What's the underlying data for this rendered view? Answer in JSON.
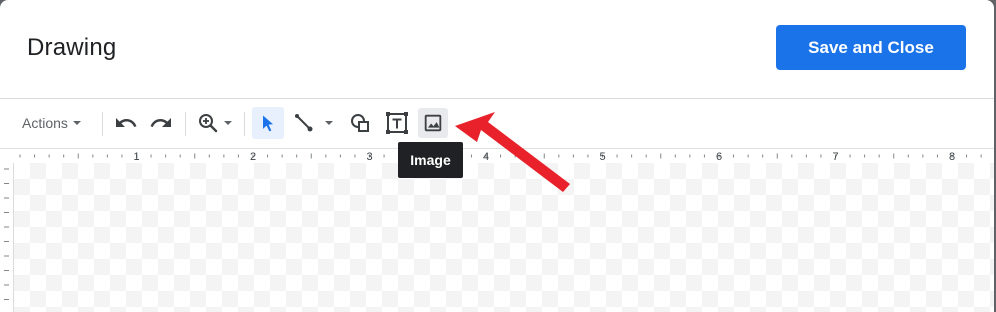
{
  "dialog": {
    "title": "Drawing",
    "save_label": "Save and Close"
  },
  "toolbar": {
    "actions_label": "Actions",
    "buttons": [
      {
        "name": "undo-icon"
      },
      {
        "name": "redo-icon"
      },
      {
        "name": "zoom-icon"
      },
      {
        "name": "select-icon",
        "selected": true
      },
      {
        "name": "line-icon"
      },
      {
        "name": "shape-icon"
      },
      {
        "name": "text-box-icon"
      },
      {
        "name": "image-icon",
        "active": true
      }
    ]
  },
  "tooltip": {
    "text": "Image"
  },
  "ruler": {
    "labels": [
      "1",
      "2",
      "3",
      "4",
      "5",
      "6",
      "7",
      "8"
    ]
  },
  "colors": {
    "accent": "#1a73e8",
    "annotation_arrow": "#e8212a",
    "tooltip_bg": "#202124"
  }
}
